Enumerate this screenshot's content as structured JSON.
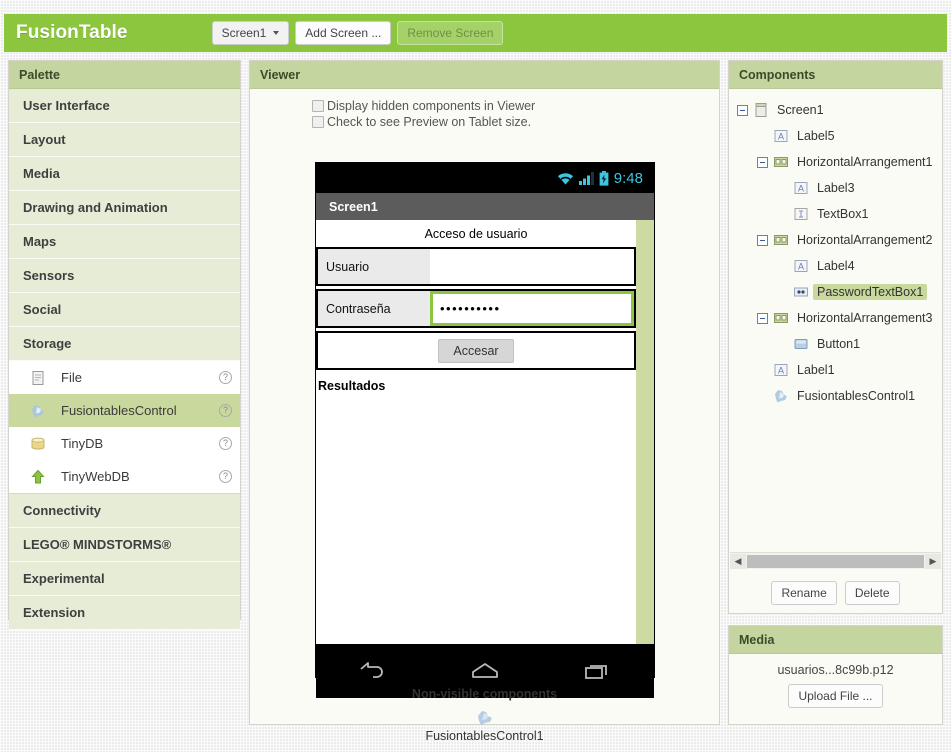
{
  "header": {
    "app_title": "FusionTable",
    "screen_selector": "Screen1",
    "add_screen_label": "Add Screen ...",
    "remove_screen_label": "Remove Screen",
    "accent_green": "#8cc63e"
  },
  "palette": {
    "title": "Palette",
    "sections": [
      {
        "label": "User Interface"
      },
      {
        "label": "Layout"
      },
      {
        "label": "Media"
      },
      {
        "label": "Drawing and Animation"
      },
      {
        "label": "Maps"
      },
      {
        "label": "Sensors"
      },
      {
        "label": "Social"
      },
      {
        "label": "Storage",
        "expanded": true
      }
    ],
    "storage_items": [
      {
        "label": "File",
        "icon": "file-icon",
        "selected": false,
        "help": "?"
      },
      {
        "label": "FusiontablesControl",
        "icon": "fusiontables-icon",
        "selected": true,
        "help": "?"
      },
      {
        "label": "TinyDB",
        "icon": "database-icon",
        "selected": false,
        "help": "?"
      },
      {
        "label": "TinyWebDB",
        "icon": "up-arrow-icon",
        "selected": false,
        "help": "?"
      }
    ],
    "sections_after": [
      {
        "label": "Connectivity"
      },
      {
        "label": "LEGO® MINDSTORMS®"
      },
      {
        "label": "Experimental"
      },
      {
        "label": "Extension"
      }
    ]
  },
  "viewer": {
    "title": "Viewer",
    "checkbox_hidden_label": "Display hidden components in Viewer",
    "checkbox_tablet_label": "Check to see Preview on Tablet size.",
    "phone": {
      "status_time": "9:48",
      "status_icons": [
        "wifi-icon",
        "signal-icon",
        "battery-icon"
      ],
      "screen_title": "Screen1",
      "form_title": "Acceso de usuario",
      "rows": [
        {
          "label": "Usuario",
          "value": "",
          "selected": false
        },
        {
          "label": "Contraseña",
          "value": "••••••••••",
          "selected": true
        }
      ],
      "button_label": "Accesar",
      "results_label": "Resultados",
      "nav_icons": [
        "back-icon",
        "home-icon",
        "recents-icon"
      ]
    },
    "nonvisible_title": "Non-visible components",
    "nonvisible_items": [
      {
        "label": "FusiontablesControl1",
        "icon": "fusiontables-icon"
      }
    ]
  },
  "components": {
    "title": "Components",
    "tree": [
      {
        "label": "Screen1",
        "depth": 0,
        "expander": true,
        "icon": "screen-icon",
        "selected": false
      },
      {
        "label": "Label5",
        "depth": 1,
        "expander": false,
        "icon": "label-icon",
        "selected": false
      },
      {
        "label": "HorizontalArrangement1",
        "depth": 1,
        "expander": true,
        "icon": "harrangement-icon",
        "selected": false
      },
      {
        "label": "Label3",
        "depth": 2,
        "expander": false,
        "icon": "label-icon",
        "selected": false
      },
      {
        "label": "TextBox1",
        "depth": 2,
        "expander": false,
        "icon": "textbox-icon",
        "selected": false
      },
      {
        "label": "HorizontalArrangement2",
        "depth": 1,
        "expander": true,
        "icon": "harrangement-icon",
        "selected": false
      },
      {
        "label": "Label4",
        "depth": 2,
        "expander": false,
        "icon": "label-icon",
        "selected": false
      },
      {
        "label": "PasswordTextBox1",
        "depth": 2,
        "expander": false,
        "icon": "password-icon",
        "selected": true
      },
      {
        "label": "HorizontalArrangement3",
        "depth": 1,
        "expander": true,
        "icon": "harrangement-icon",
        "selected": false
      },
      {
        "label": "Button1",
        "depth": 2,
        "expander": false,
        "icon": "button-icon",
        "selected": false
      },
      {
        "label": "Label1",
        "depth": 1,
        "expander": false,
        "icon": "label-icon",
        "selected": false
      },
      {
        "label": "FusiontablesControl1",
        "depth": 1,
        "expander": false,
        "icon": "fusiontables-icon",
        "selected": false
      }
    ],
    "rename_label": "Rename",
    "delete_label": "Delete",
    "scroll_left": "◀",
    "scroll_right": "▶"
  },
  "media": {
    "title": "Media",
    "file_name": "usuarios...8c99b.p12",
    "upload_label": "Upload File ..."
  }
}
